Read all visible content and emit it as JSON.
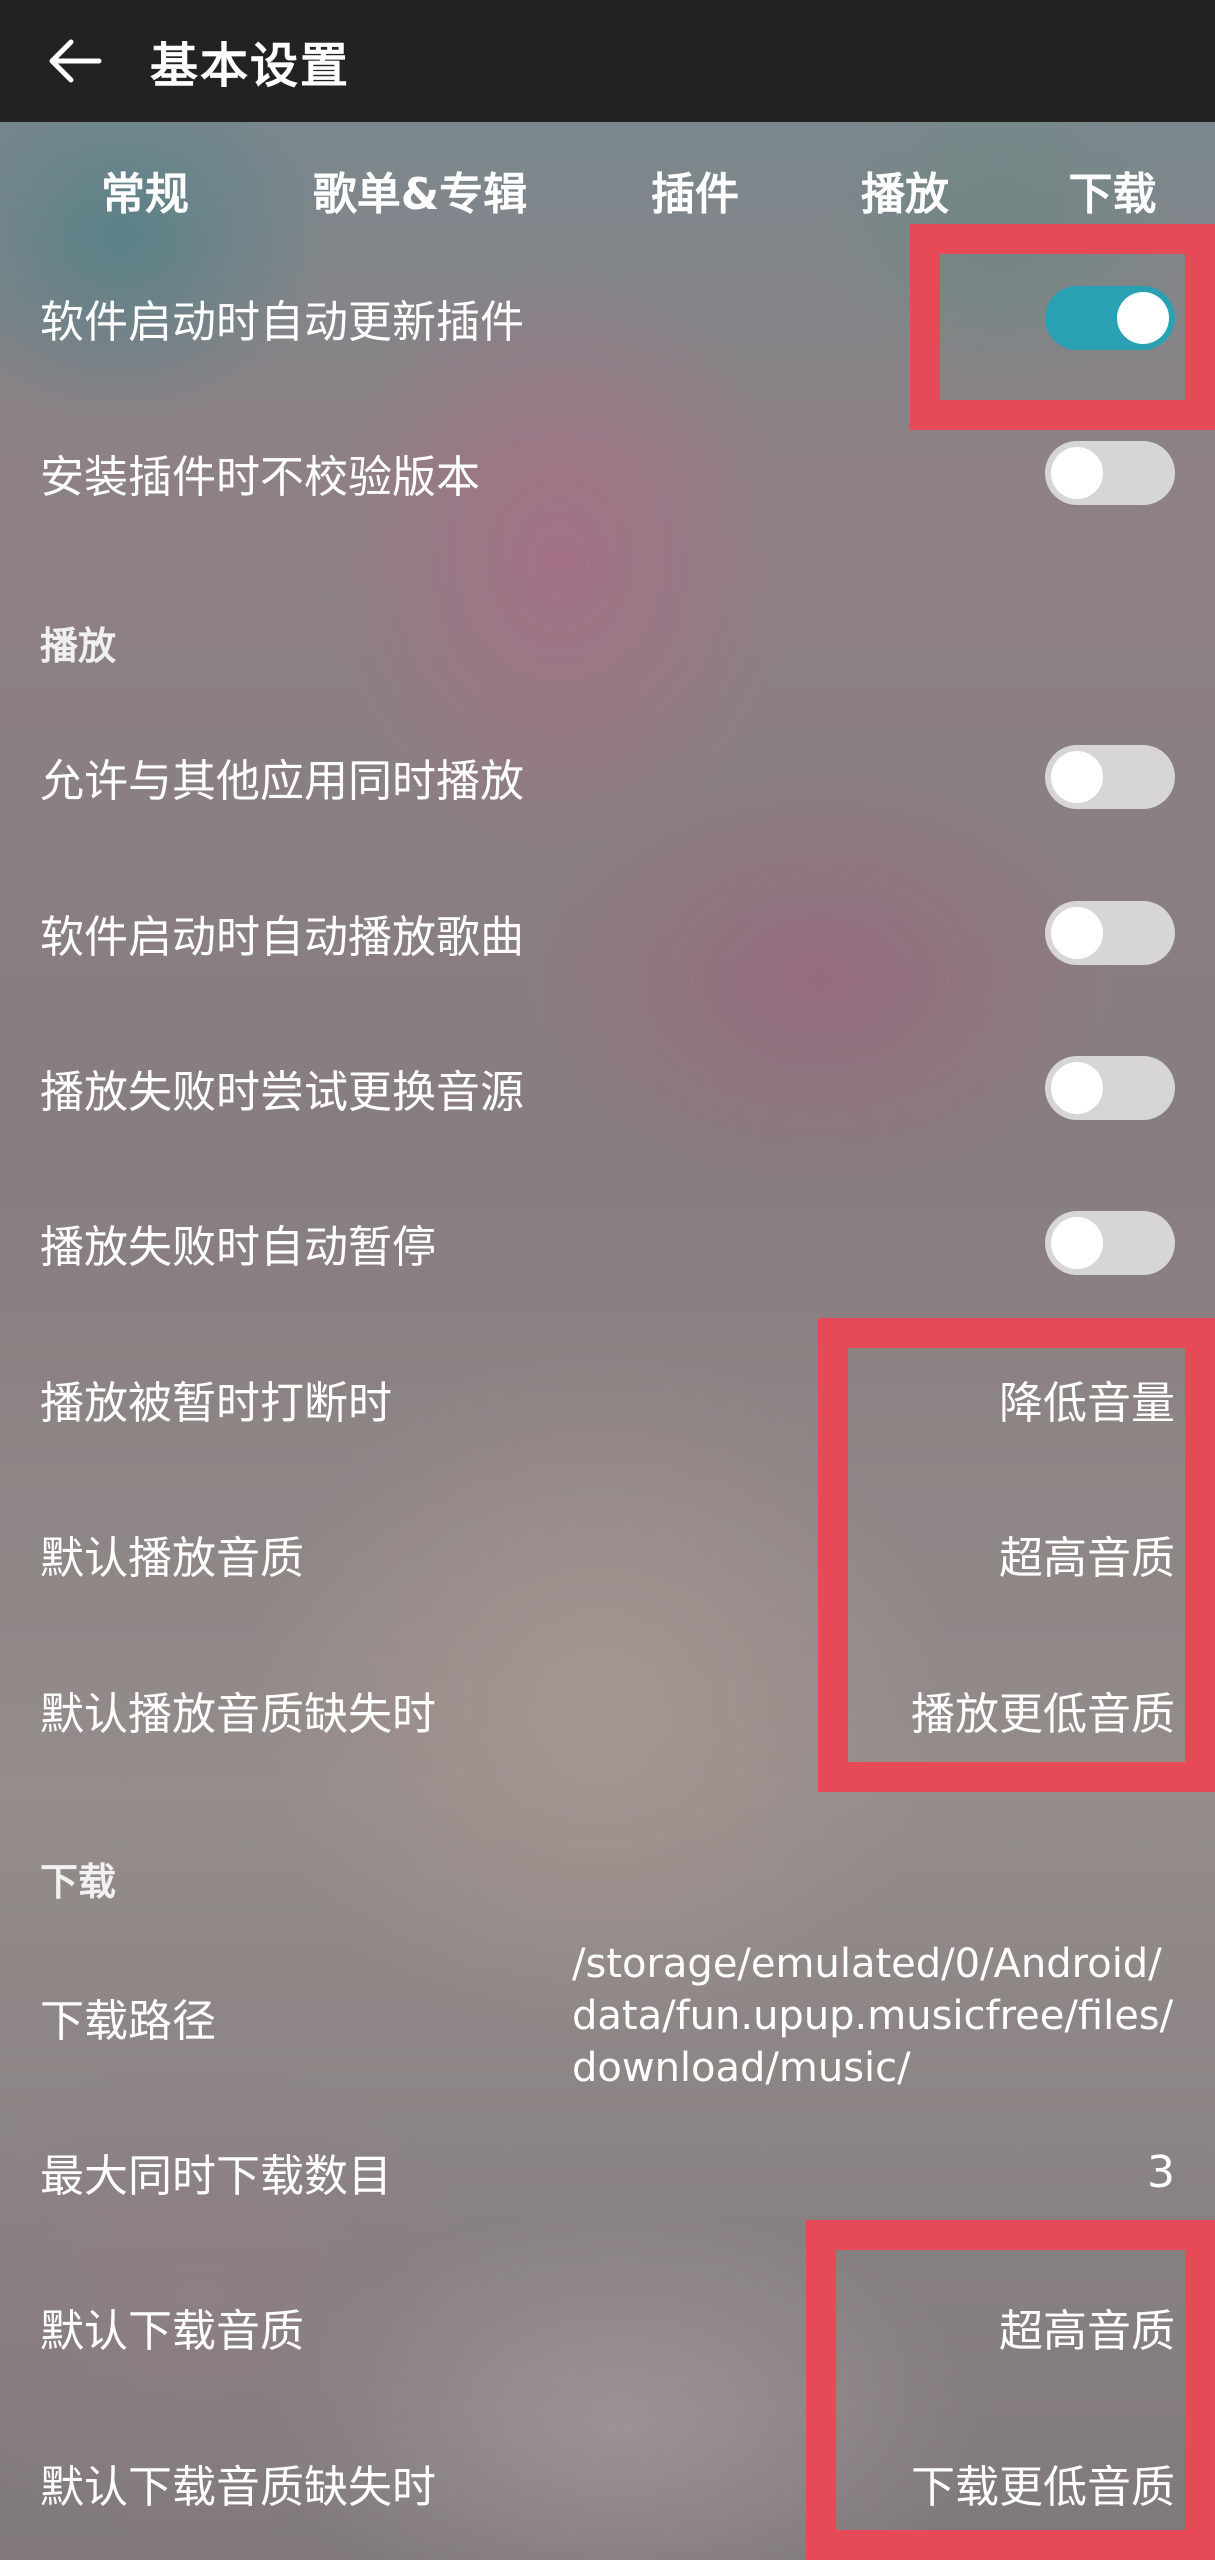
{
  "header": {
    "title": "基本设置",
    "back_icon": "arrow-left-icon"
  },
  "tabs": [
    "常规",
    "歌单&专辑",
    "插件",
    "播放",
    "下载"
  ],
  "plugin": {
    "auto_update": {
      "label": "软件启动时自动更新插件",
      "on": true
    },
    "no_version_check": {
      "label": "安装插件时不校验版本",
      "on": false
    }
  },
  "play": {
    "section": "播放",
    "allow_concurrent": {
      "label": "允许与其他应用同时播放",
      "on": false
    },
    "autoplay": {
      "label": "软件启动时自动播放歌曲",
      "on": false
    },
    "switch_source": {
      "label": "播放失败时尝试更换音源",
      "on": false
    },
    "auto_pause": {
      "label": "播放失败时自动暂停",
      "on": false
    },
    "interrupt": {
      "label": "播放被暂时打断时",
      "value": "降低音量"
    },
    "quality": {
      "label": "默认播放音质",
      "value": "超高音质"
    },
    "quality_missing": {
      "label": "默认播放音质缺失时",
      "value": "播放更低音质"
    }
  },
  "download": {
    "section": "下载",
    "path": {
      "label": "下载路径",
      "lines": [
        "/storage/emulated/0/Android/",
        "data/fun.upup.musicfree/files/",
        "download/music/"
      ]
    },
    "max_concurrent": {
      "label": "最大同时下载数目",
      "value": "3"
    },
    "quality": {
      "label": "默认下载音质",
      "value": "超高音质"
    },
    "quality_missing": {
      "label": "默认下载音质缺失时",
      "value": "下载更低音质"
    }
  },
  "colors": {
    "accent": "#2aa1b3",
    "header": "#222222",
    "highlight": "#e54a56"
  }
}
